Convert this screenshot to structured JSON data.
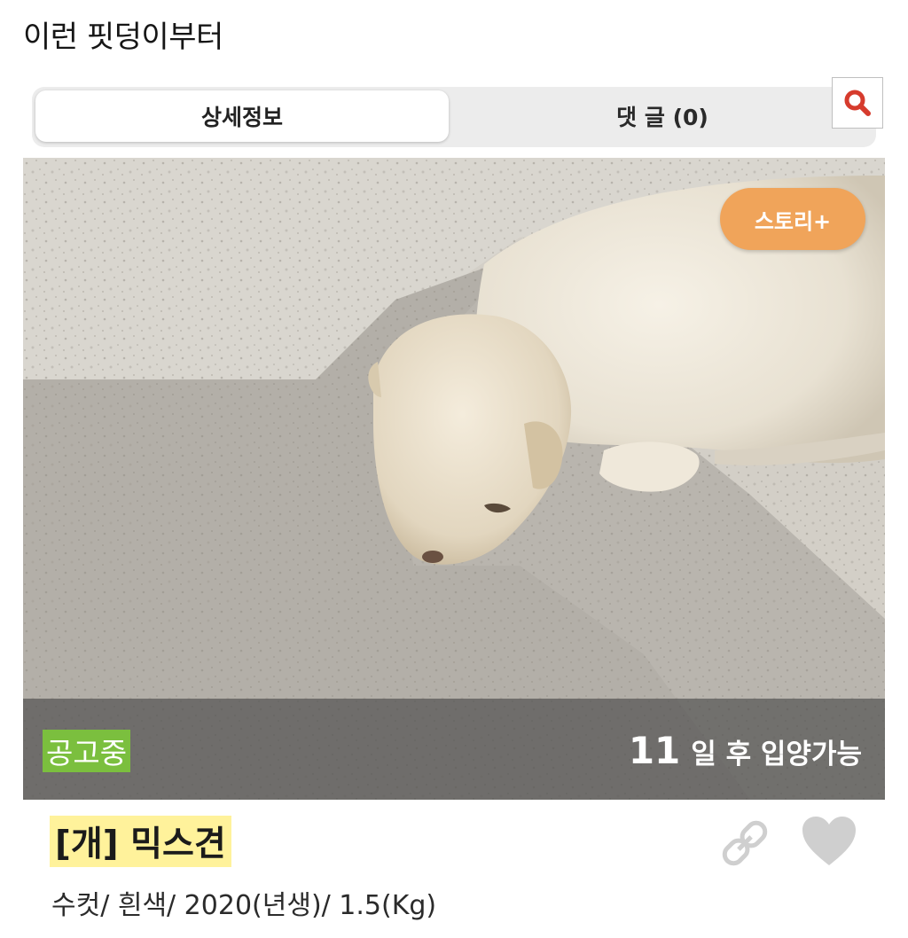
{
  "caption": "이런 핏덩이부터",
  "tabs": [
    {
      "label": "상세정보",
      "active": true
    },
    {
      "label": "댓 글 (0)",
      "active": false
    }
  ],
  "search": {
    "icon": "search-icon",
    "color": "#d63b2d"
  },
  "photo": {
    "story_button": "스토리+",
    "status_badge": "공고중",
    "adopt_days": "11",
    "adopt_label": "일 후 입양가능"
  },
  "pet": {
    "title": "[개] 믹스견",
    "details": "수컷/ 흰색/ 2020(년생)/ 1.5(Kg)"
  },
  "actions": {
    "link_icon": "link-icon",
    "heart_icon": "heart-icon"
  },
  "colors": {
    "story_button": "#f0a45a",
    "status_badge": "#7bbf3e",
    "title_highlight": "#fff29b",
    "icon_gray": "#cfcfcf"
  }
}
